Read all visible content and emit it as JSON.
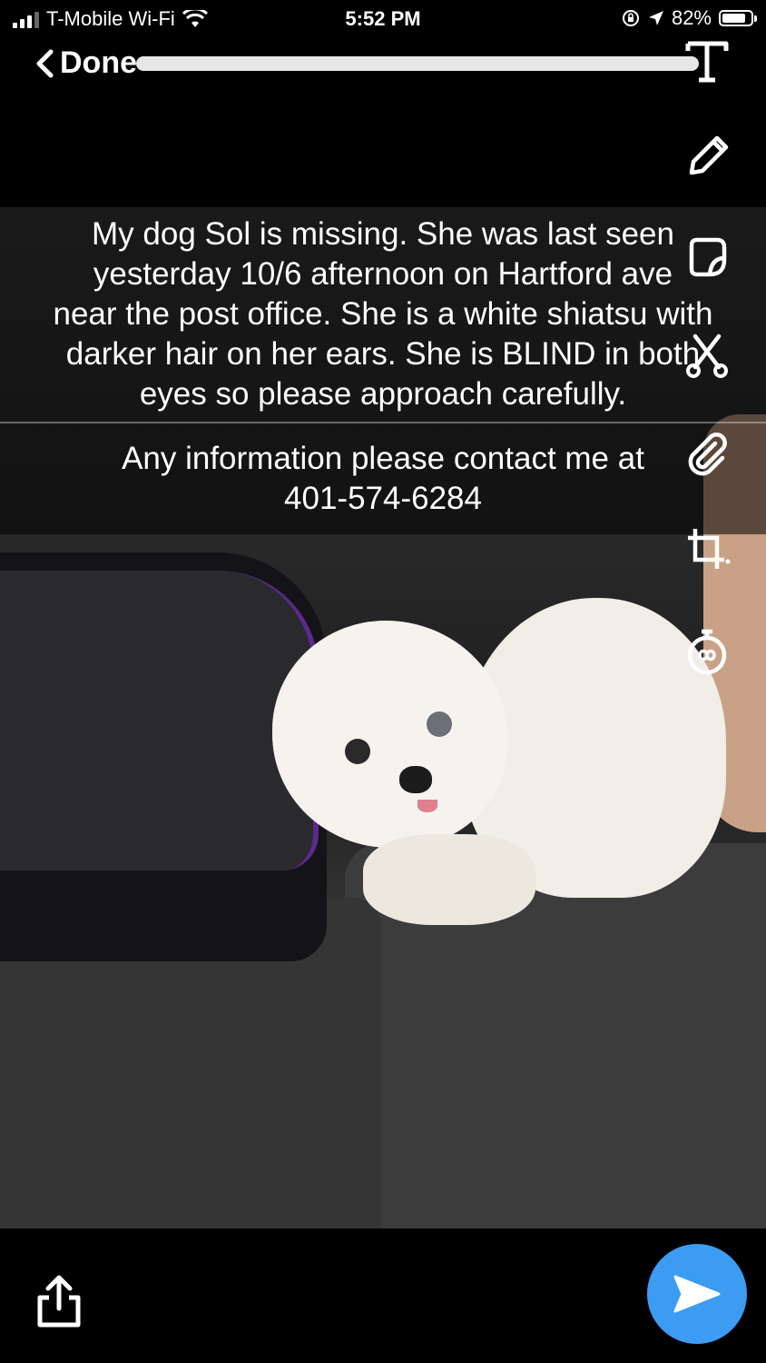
{
  "status_bar": {
    "carrier": "T-Mobile Wi-Fi",
    "time": "5:52 PM",
    "battery_percent": "82%",
    "battery_level": 0.82,
    "icons": [
      "signal-icon",
      "wifi-icon",
      "orientation-lock-icon",
      "location-arrow-icon",
      "battery-icon"
    ]
  },
  "top_bar": {
    "done_label": "Done",
    "text_tool_icon": "text-t-icon"
  },
  "tools": [
    "text-t-icon",
    "pencil-icon",
    "sticker-icon",
    "scissors-icon",
    "paperclip-icon",
    "crop-icon",
    "timer-icon"
  ],
  "caption": {
    "paragraph1": "My dog Sol is missing. She was last seen\nyesterday 10/6  afternoon on Hartford ave\nnear the post office. She is a white shiatsu with\ndarker hair on her ears. She is BLIND in both\neyes so please approach carefully.",
    "paragraph2": "Any information please contact me at\n401-574-6284"
  },
  "bottom_bar": {
    "share_icon": "share-icon",
    "send_icon": "send-arrow-icon"
  },
  "colors": {
    "send_button": "#3b9cf2",
    "background": "#000000"
  }
}
